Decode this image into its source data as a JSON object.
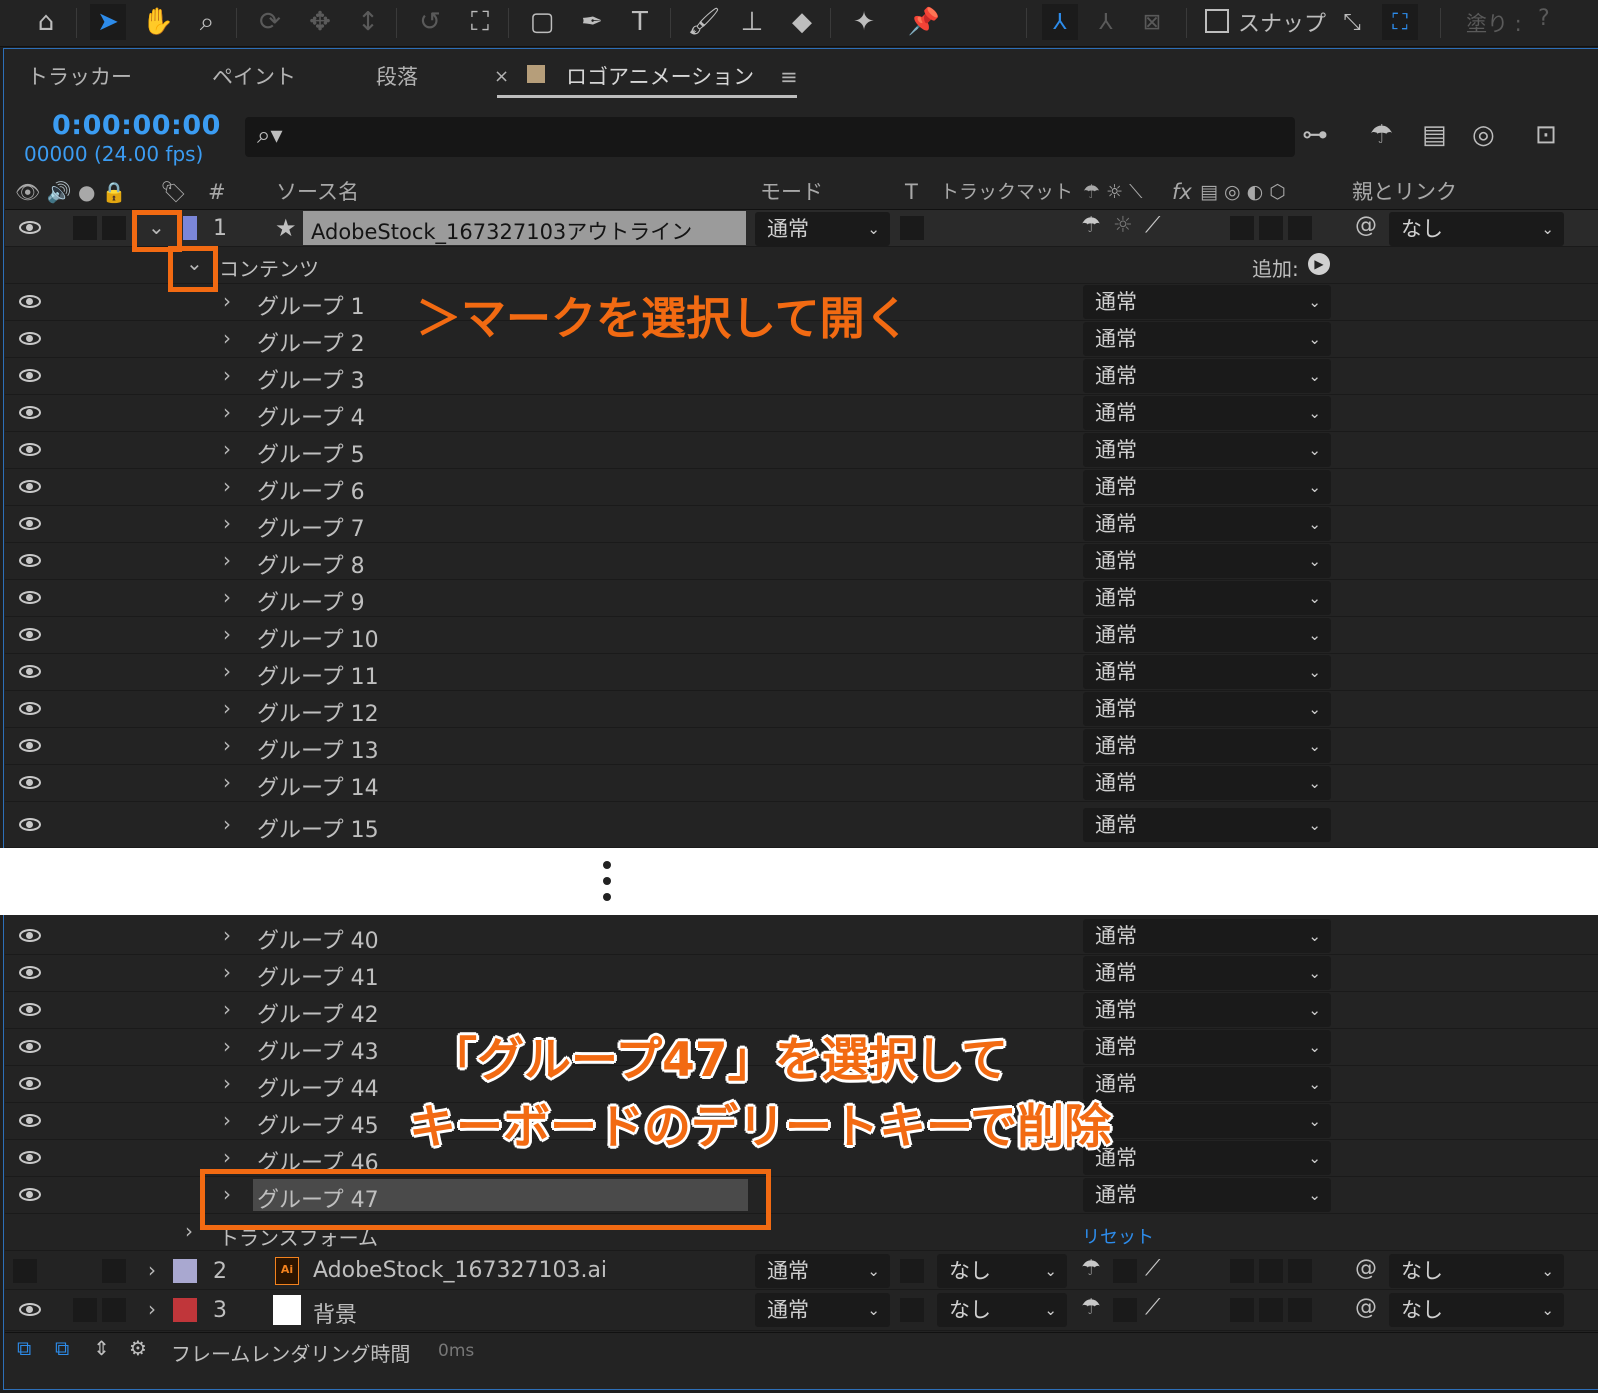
{
  "toolbar": {
    "tools": [
      "home-icon",
      "selection-tool-icon",
      "hand-tool-icon",
      "zoom-tool-icon",
      "orbit-camera-icon",
      "pan-camera-icon",
      "dolly-camera-icon",
      "rotate-tool-icon",
      "pan-behind-tool-icon",
      "rectangle-tool-icon",
      "pen-tool-icon",
      "type-tool-icon",
      "brush-tool-icon",
      "clone-stamp-tool-icon",
      "eraser-tool-icon",
      "roto-brush-tool-icon",
      "puppet-pin-tool-icon"
    ],
    "snap_label": "スナップ",
    "fill_label": "塗り :"
  },
  "tabs": [
    "トラッカー",
    "ペイント",
    "段落"
  ],
  "active_tab": {
    "close": "×",
    "label": "ロゴアニメーション",
    "menu": "≡"
  },
  "timeline": {
    "timecode": "0:00:00:00",
    "frames": "00000 (24.00 fps)",
    "search_placeholder": ""
  },
  "columns": {
    "hash": "#",
    "source_name": "ソース名",
    "mode": "モード",
    "t": "T",
    "track_matte": "トラックマット",
    "fx": "fx",
    "parent_link": "親とリンク"
  },
  "layer1": {
    "index": "1",
    "name": "AdobeStock_167327103アウトライン",
    "mode": "通常",
    "parent": "なし",
    "label_color": "#7b86d8"
  },
  "contents": {
    "label": "コンテンツ",
    "add_label": "追加:"
  },
  "groups_top": [
    {
      "name": "グループ 1",
      "mode": "通常"
    },
    {
      "name": "グループ 2",
      "mode": "通常"
    },
    {
      "name": "グループ 3",
      "mode": "通常"
    },
    {
      "name": "グループ 4",
      "mode": "通常"
    },
    {
      "name": "グループ 5",
      "mode": "通常"
    },
    {
      "name": "グループ 6",
      "mode": "通常"
    },
    {
      "name": "グループ 7",
      "mode": "通常"
    },
    {
      "name": "グループ 8",
      "mode": "通常"
    },
    {
      "name": "グループ 9",
      "mode": "通常"
    },
    {
      "name": "グループ 10",
      "mode": "通常"
    },
    {
      "name": "グループ 11",
      "mode": "通常"
    },
    {
      "name": "グループ 12",
      "mode": "通常"
    },
    {
      "name": "グループ 13",
      "mode": "通常"
    },
    {
      "name": "グループ 14",
      "mode": "通常"
    },
    {
      "name": "グループ 15",
      "mode": "通常"
    }
  ],
  "groups_bottom": [
    {
      "name": "グループ 40",
      "mode": "通常"
    },
    {
      "name": "グループ 41",
      "mode": "通常"
    },
    {
      "name": "グループ 42",
      "mode": "通常"
    },
    {
      "name": "グループ 43",
      "mode": "通常"
    },
    {
      "name": "グループ 44",
      "mode": "通常"
    },
    {
      "name": "グループ 45",
      "mode": ""
    },
    {
      "name": "グループ 46",
      "mode": "通常"
    },
    {
      "name": "グループ 47",
      "mode": "通常"
    }
  ],
  "transform": {
    "label": "トランスフォーム",
    "reset": "リセット"
  },
  "layer2": {
    "index": "2",
    "name": "AdobeStock_167327103.ai",
    "mode": "通常",
    "matte": "なし",
    "parent": "なし",
    "label_color": "#a9a8d0",
    "file_badge": "Ai"
  },
  "layer3": {
    "index": "3",
    "name": "背景",
    "mode": "通常",
    "matte": "なし",
    "parent": "なし",
    "label_color": "#c0363a"
  },
  "status": {
    "label": "フレームレンダリング時間",
    "value": "0ms"
  },
  "annotations": {
    "open_mark": "＞マークを選択して開く",
    "delete_line1": "「グループ47」を選択して",
    "delete_line2": "キーボードのデリートキーで削除"
  },
  "colors": {
    "accent": "#2d8ceb",
    "timecode": "#3b9cf2",
    "annotation": "#f26a12"
  }
}
